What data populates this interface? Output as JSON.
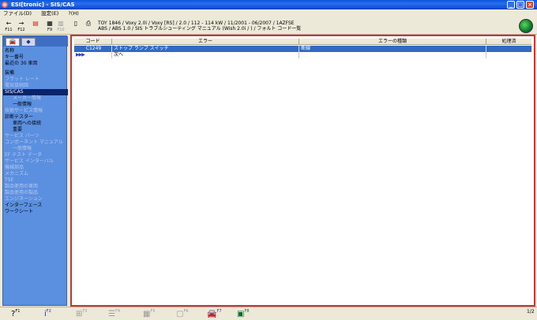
{
  "window": {
    "title": "ESI[tronic] - SIS/CAS",
    "controls": [
      "_",
      "□",
      "×"
    ]
  },
  "menu": [
    "ファイル(D)",
    "設定(E)",
    "?(H)"
  ],
  "toolbar": {
    "f11_label": "F11",
    "f12_label": "F12",
    "tb_f9": "F9",
    "tb_f10": "F10"
  },
  "vehicle": {
    "line1": "TOY 1846 / Voxy 2.0i / Voxy [RS] / 2.0 / 112 - 114 kW / 11/2001 - 06/2007 / 1AZFSE",
    "line2": "ABS / ABS 1.0 / SIS トラブルシューティング マニュアル  (Wish 2.0i  /  ) / フォルト コード一覧"
  },
  "sidebar": {
    "items": [
      {
        "label": "名称",
        "state": "enabled"
      },
      {
        "label": "キー番号",
        "state": "enabled"
      },
      {
        "label": "最近の 30 車両",
        "state": "enabled"
      },
      {
        "label": "装備",
        "state": "enabled"
      },
      {
        "label": "フラット レート",
        "state": "disabled"
      },
      {
        "label": "電気接続図",
        "state": "disabled"
      },
      {
        "label": "SIS/CAS",
        "state": "selected"
      },
      {
        "label": "メーカー情報",
        "state": "disabled-indent"
      },
      {
        "label": "一般情報",
        "state": "enabled-indent"
      },
      {
        "label": "技術サービス情報",
        "state": "disabled"
      },
      {
        "label": "診断テスター",
        "state": "enabled"
      },
      {
        "label": "車両への接続",
        "state": "enabled-indent"
      },
      {
        "label": "重要",
        "state": "enabled-indent"
      },
      {
        "label": "サービス パーツ",
        "state": "disabled"
      },
      {
        "label": "コンポーネント マニュアル",
        "state": "disabled"
      },
      {
        "label": "一般情報",
        "state": "disabled-indent"
      },
      {
        "label": "EF テスト データ",
        "state": "disabled"
      },
      {
        "label": "サービス インターバル",
        "state": "disabled"
      },
      {
        "label": "機械部品",
        "state": "disabled"
      },
      {
        "label": "メカニズム",
        "state": "disabled"
      },
      {
        "label": "TSE",
        "state": "disabled"
      },
      {
        "label": "製品使用の車両",
        "state": "disabled"
      },
      {
        "label": "製品使用の製品",
        "state": "disabled"
      },
      {
        "label": "エンジネーション",
        "state": "disabled"
      },
      {
        "label": "インターフェース",
        "state": "enabled"
      },
      {
        "label": "ワークシート",
        "state": "enabled"
      }
    ]
  },
  "grid": {
    "columns": [
      "コード",
      "エラー",
      "エラーの種類",
      "処理済"
    ],
    "rows": [
      {
        "code": "C1249",
        "error": "ストップ ランプ スイッチ",
        "type": "断線",
        "done": "",
        "selected": true
      },
      {
        "code": "",
        "error": "次へ",
        "type": "",
        "done": "",
        "selected": false,
        "marker": "▶▶▶"
      }
    ]
  },
  "bottombar": {
    "help_fkey": "F1",
    "info_fkey": "F2",
    "f3": "F3",
    "f4": "F4",
    "f5": "F5",
    "f6": "F6",
    "f7": "F7",
    "f8": "F8",
    "page": "1/2"
  }
}
